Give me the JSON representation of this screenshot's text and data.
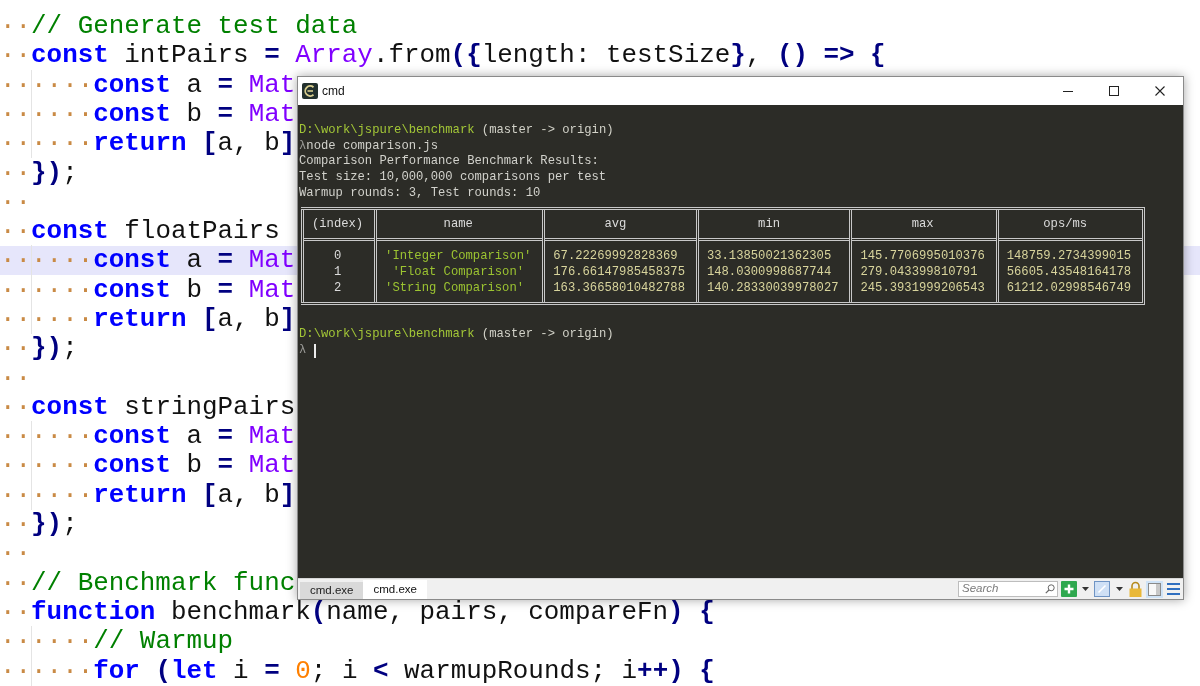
{
  "editor": {
    "lines": [
      {
        "indent": "··",
        "current": false,
        "tokens": [
          {
            "kind": "comment",
            "text": "// Generate test data"
          }
        ]
      },
      {
        "indent": "··",
        "current": false,
        "tokens": [
          {
            "kind": "keyword",
            "text": "const"
          },
          {
            "kind": "plain",
            "text": " intPairs "
          },
          {
            "kind": "operator",
            "text": "= "
          },
          {
            "kind": "builtin",
            "text": "Array"
          },
          {
            "kind": "plain",
            "text": ".from"
          },
          {
            "kind": "operator",
            "text": "({"
          },
          {
            "kind": "plain",
            "text": "length: testSize"
          },
          {
            "kind": "operator",
            "text": "}"
          },
          {
            "kind": "plain",
            "text": ", "
          },
          {
            "kind": "operator",
            "text": "() => {"
          }
        ]
      },
      {
        "indent": "······",
        "current": false,
        "tokens": [
          {
            "kind": "keyword",
            "text": "const"
          },
          {
            "kind": "plain",
            "text": " a "
          },
          {
            "kind": "operator",
            "text": "= "
          },
          {
            "kind": "builtin",
            "text": "Mat"
          }
        ]
      },
      {
        "indent": "······",
        "current": false,
        "tokens": [
          {
            "kind": "keyword",
            "text": "const"
          },
          {
            "kind": "plain",
            "text": " b "
          },
          {
            "kind": "operator",
            "text": "= "
          },
          {
            "kind": "builtin",
            "text": "Mat"
          }
        ]
      },
      {
        "indent": "······",
        "current": false,
        "tokens": [
          {
            "kind": "keyword",
            "text": "return"
          },
          {
            "kind": "operator",
            "text": " ["
          },
          {
            "kind": "plain",
            "text": "a, b"
          },
          {
            "kind": "operator",
            "text": "]"
          }
        ]
      },
      {
        "indent": "··",
        "current": false,
        "tokens": [
          {
            "kind": "operator",
            "text": "})"
          },
          {
            "kind": "plain",
            "text": ";"
          }
        ]
      },
      {
        "indent": "··",
        "current": false
      },
      {
        "indent": "··",
        "current": false,
        "tokens": [
          {
            "kind": "keyword",
            "text": "const"
          },
          {
            "kind": "plain",
            "text": " floatPairs"
          }
        ]
      },
      {
        "indent": "······",
        "current": true,
        "tokens": [
          {
            "kind": "keyword",
            "text": "const"
          },
          {
            "kind": "plain",
            "text": " a "
          },
          {
            "kind": "operator",
            "text": "= "
          },
          {
            "kind": "builtin",
            "text": "Mat"
          }
        ]
      },
      {
        "indent": "······",
        "current": false,
        "tokens": [
          {
            "kind": "keyword",
            "text": "const"
          },
          {
            "kind": "plain",
            "text": " b "
          },
          {
            "kind": "operator",
            "text": "= "
          },
          {
            "kind": "builtin",
            "text": "Mat"
          }
        ]
      },
      {
        "indent": "······",
        "current": false,
        "tokens": [
          {
            "kind": "keyword",
            "text": "return"
          },
          {
            "kind": "operator",
            "text": " ["
          },
          {
            "kind": "plain",
            "text": "a, b"
          },
          {
            "kind": "operator",
            "text": "]"
          }
        ]
      },
      {
        "indent": "··",
        "current": false,
        "tokens": [
          {
            "kind": "operator",
            "text": "})"
          },
          {
            "kind": "plain",
            "text": ";"
          }
        ]
      },
      {
        "indent": "··",
        "current": false
      },
      {
        "indent": "··",
        "current": false,
        "tokens": [
          {
            "kind": "keyword",
            "text": "const"
          },
          {
            "kind": "plain",
            "text": " stringPairs"
          }
        ]
      },
      {
        "indent": "······",
        "current": false,
        "tokens": [
          {
            "kind": "keyword",
            "text": "const"
          },
          {
            "kind": "plain",
            "text": " a "
          },
          {
            "kind": "operator",
            "text": "= "
          },
          {
            "kind": "builtin",
            "text": "Mat"
          }
        ]
      },
      {
        "indent": "······",
        "current": false,
        "tokens": [
          {
            "kind": "keyword",
            "text": "const"
          },
          {
            "kind": "plain",
            "text": " b "
          },
          {
            "kind": "operator",
            "text": "= "
          },
          {
            "kind": "builtin",
            "text": "Mat"
          }
        ]
      },
      {
        "indent": "······",
        "current": false,
        "tokens": [
          {
            "kind": "keyword",
            "text": "return"
          },
          {
            "kind": "operator",
            "text": " ["
          },
          {
            "kind": "plain",
            "text": "a, b"
          },
          {
            "kind": "operator",
            "text": "]"
          }
        ]
      },
      {
        "indent": "··",
        "current": false,
        "tokens": [
          {
            "kind": "operator",
            "text": "})"
          },
          {
            "kind": "plain",
            "text": ";"
          }
        ]
      },
      {
        "indent": "··",
        "current": false
      },
      {
        "indent": "··",
        "current": false,
        "tokens": [
          {
            "kind": "comment",
            "text": "// Benchmark func"
          }
        ]
      },
      {
        "indent": "··",
        "current": false,
        "tokens": [
          {
            "kind": "keyword",
            "text": "function"
          },
          {
            "kind": "plain",
            "text": " benchmark"
          },
          {
            "kind": "operator",
            "text": "("
          },
          {
            "kind": "plain",
            "text": "name, pairs, compareFn"
          },
          {
            "kind": "operator",
            "text": ") {"
          }
        ]
      },
      {
        "indent": "······",
        "current": false,
        "tokens": [
          {
            "kind": "comment",
            "text": "// Warmup"
          }
        ]
      },
      {
        "indent": "······",
        "current": false,
        "tokens": [
          {
            "kind": "keyword",
            "text": "for"
          },
          {
            "kind": "operator",
            "text": " ("
          },
          {
            "kind": "keyword",
            "text": "let"
          },
          {
            "kind": "plain",
            "text": " i "
          },
          {
            "kind": "operator",
            "text": "= "
          },
          {
            "kind": "number",
            "text": "0"
          },
          {
            "kind": "plain",
            "text": "; i "
          },
          {
            "kind": "operator",
            "text": "<"
          },
          {
            "kind": "plain",
            "text": " warmupRounds; i"
          },
          {
            "kind": "operator",
            "text": "++) {"
          }
        ]
      }
    ]
  },
  "terminal_window": {
    "title": "cmd",
    "output": [
      {
        "kind": "prompt",
        "path": "D:\\work\\jspure\\benchmark",
        "branch": "(master -> origin)"
      },
      {
        "kind": "command",
        "symbol": "λ",
        "text": "node comparison.js"
      },
      {
        "kind": "text",
        "text": "Comparison Performance Benchmark Results:"
      },
      {
        "kind": "text",
        "text": "Test size: 10,000,000 comparisons per test"
      },
      {
        "kind": "text",
        "text": "Warmup rounds: 3, Test rounds: 10"
      },
      {
        "kind": "table",
        "columns": [
          {
            "label": "(index)",
            "kind": "index"
          },
          {
            "label": "name",
            "kind": "string"
          },
          {
            "label": "avg",
            "kind": "number"
          },
          {
            "label": "min",
            "kind": "number"
          },
          {
            "label": "max",
            "kind": "number"
          },
          {
            "label": "ops/ms",
            "kind": "number"
          }
        ],
        "rows": [
          [
            "0",
            "'Integer Comparison'",
            "67.22269992828369",
            "33.13850021362305",
            "145.7706995010376",
            "148759.2734399015"
          ],
          [
            "1",
            "'Float Comparison'",
            "176.66147985458375",
            "148.0300998687744",
            "279.043399810791",
            "56605.43548164178"
          ],
          [
            "2",
            "'String Comparison'",
            "163.36658010482788",
            "140.28330039978027",
            "245.3931999206543",
            "61212.02998546749"
          ]
        ]
      },
      {
        "kind": "blank"
      },
      {
        "kind": "prompt",
        "path": "D:\\work\\jspure\\benchmark",
        "branch": "(master -> origin)"
      },
      {
        "kind": "input",
        "symbol": "λ"
      }
    ],
    "tabs": [
      {
        "label": "cmd.exe",
        "selected": false
      },
      {
        "label": "cmd.exe",
        "selected": true
      }
    ],
    "search": {
      "placeholder": "Search"
    }
  }
}
